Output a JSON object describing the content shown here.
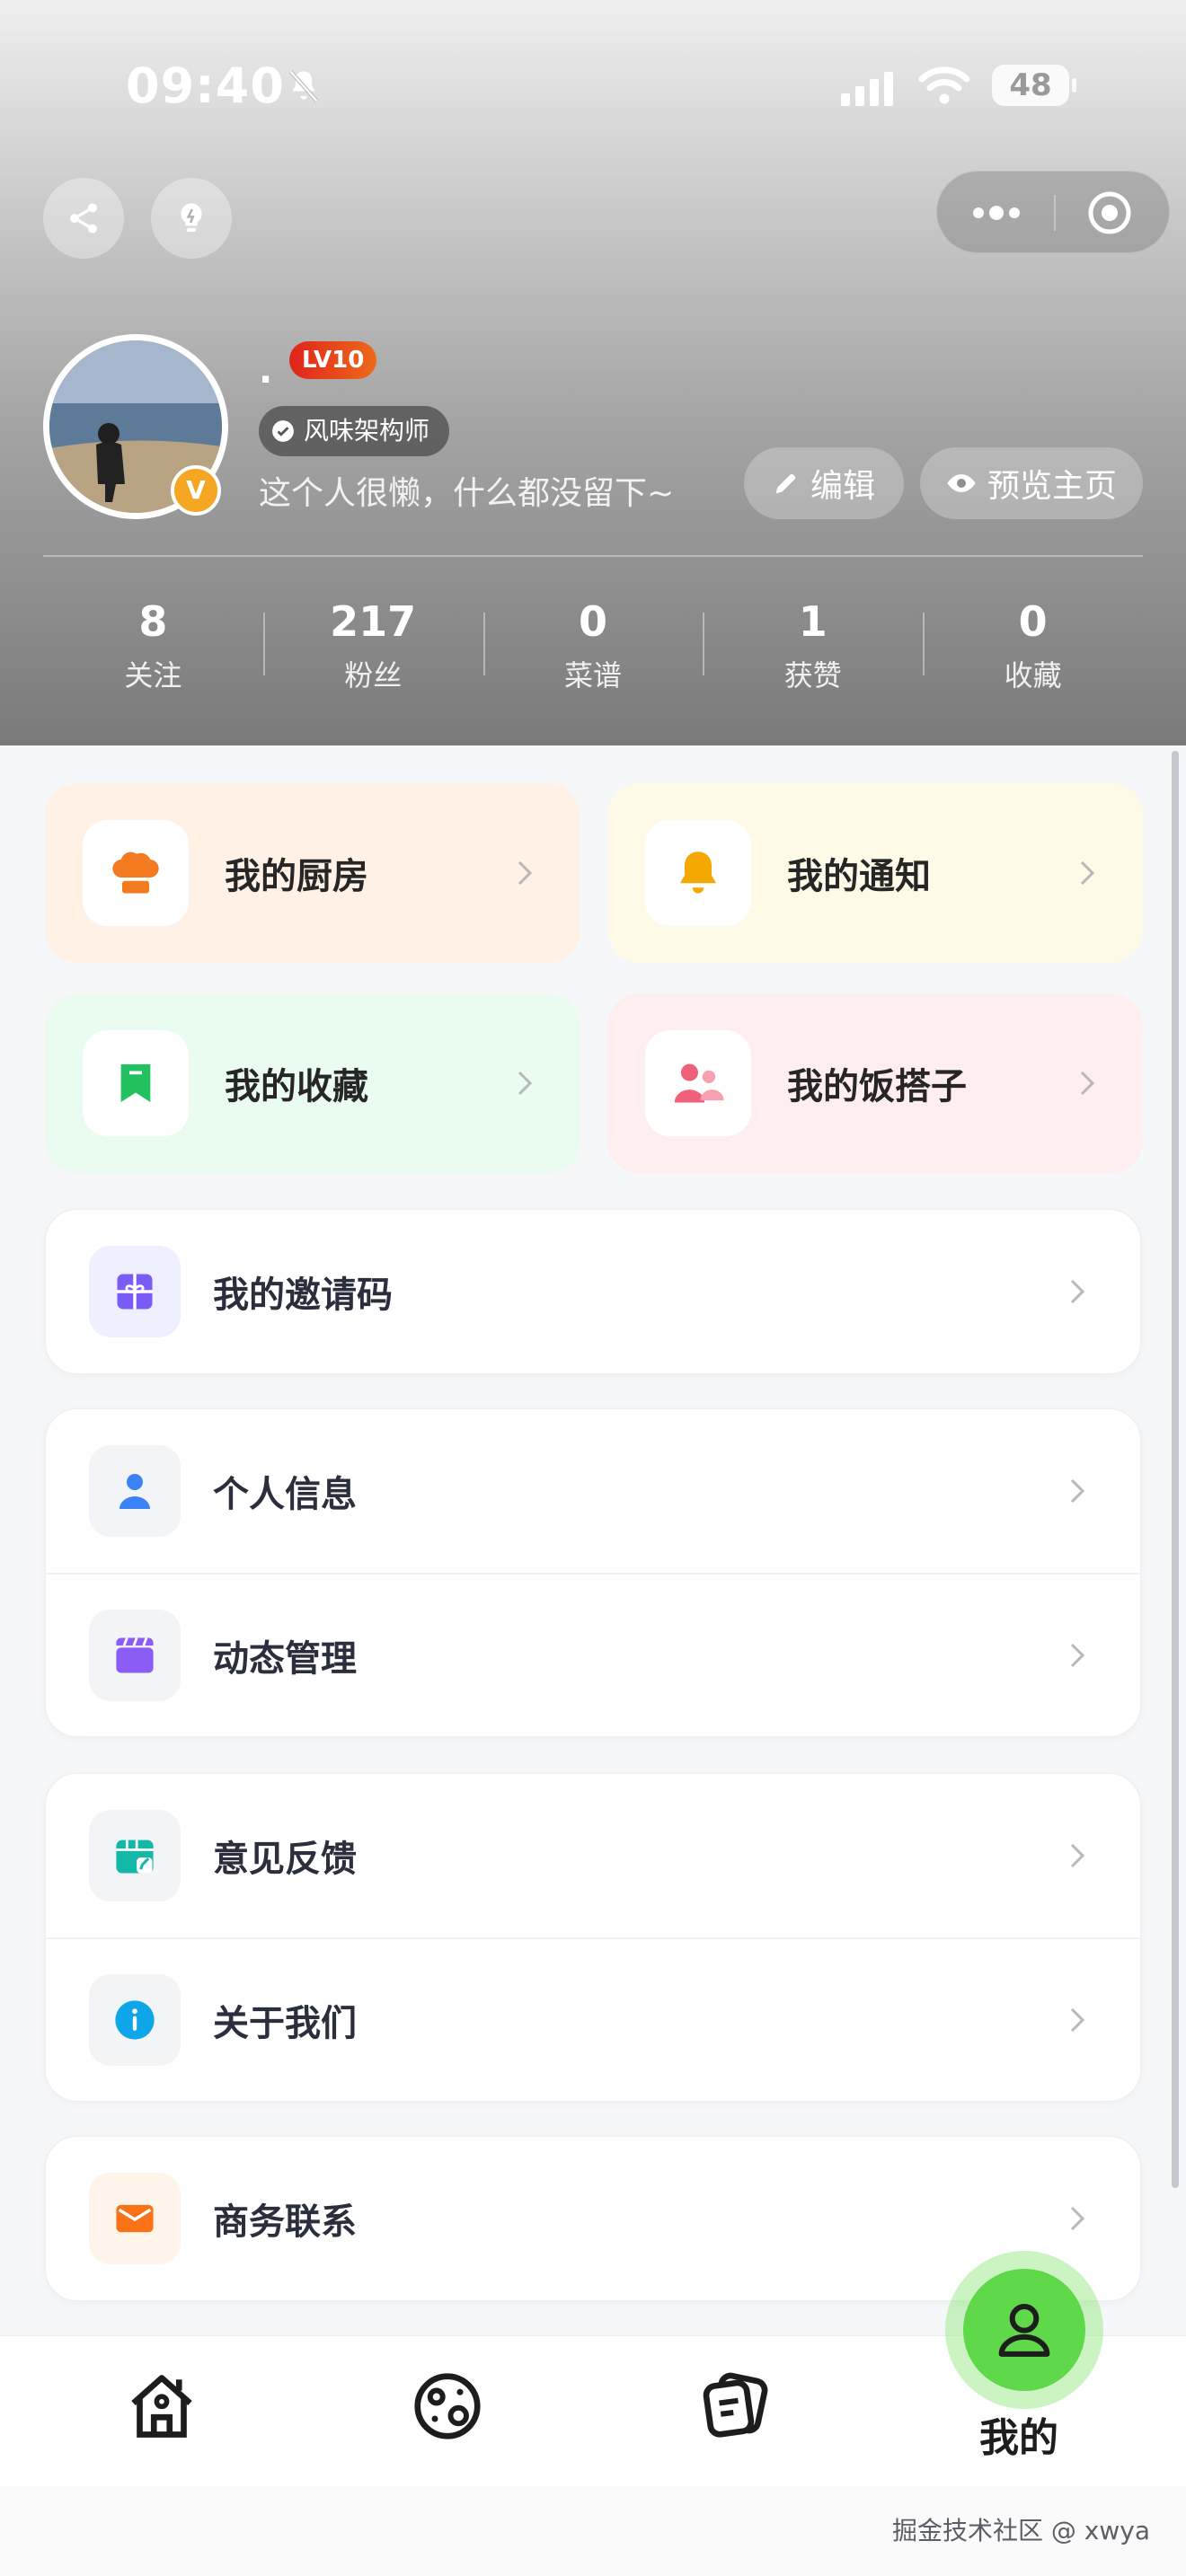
{
  "status_bar": {
    "time": "09:40",
    "battery": "48"
  },
  "profile": {
    "name": ".",
    "level": "LV10",
    "title_badge": "风味架构师",
    "avatar_badge": "V",
    "bio": "这个人很懒，什么都没留下~",
    "edit_label": "编辑",
    "preview_label": "预览主页"
  },
  "stats": [
    {
      "value": "8",
      "label": "关注"
    },
    {
      "value": "217",
      "label": "粉丝"
    },
    {
      "value": "0",
      "label": "菜谱"
    },
    {
      "value": "1",
      "label": "获赞"
    },
    {
      "value": "0",
      "label": "收藏"
    }
  ],
  "tiles": [
    {
      "label": "我的厨房",
      "icon": "chef-hat-icon",
      "bg": "#fff1e6",
      "color": "#f47a1f"
    },
    {
      "label": "我的通知",
      "icon": "bell-icon",
      "bg": "#fff9e8",
      "color": "#f5a800"
    },
    {
      "label": "我的收藏",
      "icon": "bookmark-icon",
      "bg": "#eafbef",
      "color": "#22c160"
    },
    {
      "label": "我的饭搭子",
      "icon": "people-icon",
      "bg": "#ffeef0",
      "color": "#f0607a"
    }
  ],
  "menu": {
    "invite": "我的邀请码",
    "profile_info": "个人信息",
    "posts": "动态管理",
    "feedback": "意见反馈",
    "about": "关于我们",
    "business": "商务联系"
  },
  "tabbar": {
    "mine_label": "我的"
  },
  "watermark": "掘金技术社区 @ xwya"
}
